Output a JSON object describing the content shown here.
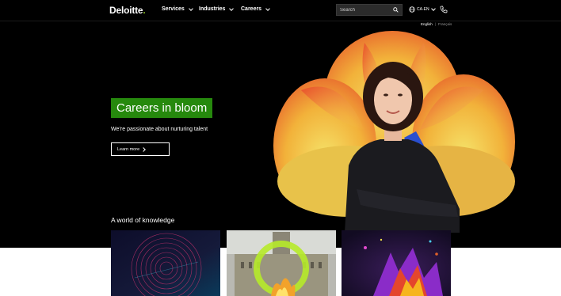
{
  "header": {
    "logo": "Deloitte",
    "logo_dot": ".",
    "nav": [
      {
        "label": "Services"
      },
      {
        "label": "Industries"
      },
      {
        "label": "Careers"
      }
    ],
    "search_placeholder": "Search",
    "locale": "CA-EN",
    "icons": {
      "search": "search-icon",
      "globe": "globe-icon",
      "phone": "phone-icon"
    }
  },
  "languages": {
    "english": "English",
    "separator": "|",
    "french": "Français"
  },
  "hero": {
    "title": "Careers in bloom",
    "subtitle": "We’re passionate about nurturing talent",
    "button": "Learn more"
  },
  "section": {
    "title": "A world of knowledge"
  },
  "colors": {
    "brand_green": "#86bc25",
    "title_bg": "#26890d",
    "background": "#000000"
  }
}
